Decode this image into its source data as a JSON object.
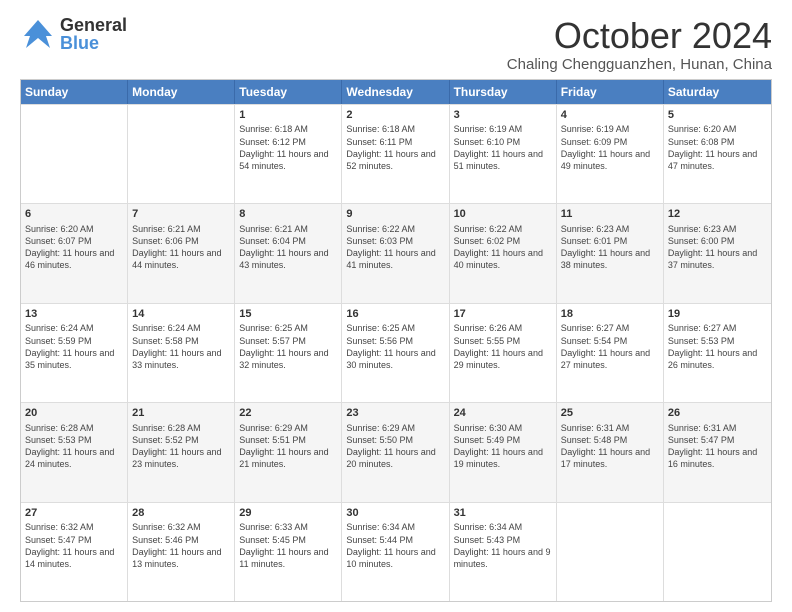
{
  "logo": {
    "general": "General",
    "blue": "Blue"
  },
  "title": "October 2024",
  "location": "Chaling Chengguanzhen, Hunan, China",
  "days_of_week": [
    "Sunday",
    "Monday",
    "Tuesday",
    "Wednesday",
    "Thursday",
    "Friday",
    "Saturday"
  ],
  "weeks": [
    [
      {
        "day": "",
        "info": ""
      },
      {
        "day": "",
        "info": ""
      },
      {
        "day": "1",
        "info": "Sunrise: 6:18 AM\nSunset: 6:12 PM\nDaylight: 11 hours and 54 minutes."
      },
      {
        "day": "2",
        "info": "Sunrise: 6:18 AM\nSunset: 6:11 PM\nDaylight: 11 hours and 52 minutes."
      },
      {
        "day": "3",
        "info": "Sunrise: 6:19 AM\nSunset: 6:10 PM\nDaylight: 11 hours and 51 minutes."
      },
      {
        "day": "4",
        "info": "Sunrise: 6:19 AM\nSunset: 6:09 PM\nDaylight: 11 hours and 49 minutes."
      },
      {
        "day": "5",
        "info": "Sunrise: 6:20 AM\nSunset: 6:08 PM\nDaylight: 11 hours and 47 minutes."
      }
    ],
    [
      {
        "day": "6",
        "info": "Sunrise: 6:20 AM\nSunset: 6:07 PM\nDaylight: 11 hours and 46 minutes."
      },
      {
        "day": "7",
        "info": "Sunrise: 6:21 AM\nSunset: 6:06 PM\nDaylight: 11 hours and 44 minutes."
      },
      {
        "day": "8",
        "info": "Sunrise: 6:21 AM\nSunset: 6:04 PM\nDaylight: 11 hours and 43 minutes."
      },
      {
        "day": "9",
        "info": "Sunrise: 6:22 AM\nSunset: 6:03 PM\nDaylight: 11 hours and 41 minutes."
      },
      {
        "day": "10",
        "info": "Sunrise: 6:22 AM\nSunset: 6:02 PM\nDaylight: 11 hours and 40 minutes."
      },
      {
        "day": "11",
        "info": "Sunrise: 6:23 AM\nSunset: 6:01 PM\nDaylight: 11 hours and 38 minutes."
      },
      {
        "day": "12",
        "info": "Sunrise: 6:23 AM\nSunset: 6:00 PM\nDaylight: 11 hours and 37 minutes."
      }
    ],
    [
      {
        "day": "13",
        "info": "Sunrise: 6:24 AM\nSunset: 5:59 PM\nDaylight: 11 hours and 35 minutes."
      },
      {
        "day": "14",
        "info": "Sunrise: 6:24 AM\nSunset: 5:58 PM\nDaylight: 11 hours and 33 minutes."
      },
      {
        "day": "15",
        "info": "Sunrise: 6:25 AM\nSunset: 5:57 PM\nDaylight: 11 hours and 32 minutes."
      },
      {
        "day": "16",
        "info": "Sunrise: 6:25 AM\nSunset: 5:56 PM\nDaylight: 11 hours and 30 minutes."
      },
      {
        "day": "17",
        "info": "Sunrise: 6:26 AM\nSunset: 5:55 PM\nDaylight: 11 hours and 29 minutes."
      },
      {
        "day": "18",
        "info": "Sunrise: 6:27 AM\nSunset: 5:54 PM\nDaylight: 11 hours and 27 minutes."
      },
      {
        "day": "19",
        "info": "Sunrise: 6:27 AM\nSunset: 5:53 PM\nDaylight: 11 hours and 26 minutes."
      }
    ],
    [
      {
        "day": "20",
        "info": "Sunrise: 6:28 AM\nSunset: 5:53 PM\nDaylight: 11 hours and 24 minutes."
      },
      {
        "day": "21",
        "info": "Sunrise: 6:28 AM\nSunset: 5:52 PM\nDaylight: 11 hours and 23 minutes."
      },
      {
        "day": "22",
        "info": "Sunrise: 6:29 AM\nSunset: 5:51 PM\nDaylight: 11 hours and 21 minutes."
      },
      {
        "day": "23",
        "info": "Sunrise: 6:29 AM\nSunset: 5:50 PM\nDaylight: 11 hours and 20 minutes."
      },
      {
        "day": "24",
        "info": "Sunrise: 6:30 AM\nSunset: 5:49 PM\nDaylight: 11 hours and 19 minutes."
      },
      {
        "day": "25",
        "info": "Sunrise: 6:31 AM\nSunset: 5:48 PM\nDaylight: 11 hours and 17 minutes."
      },
      {
        "day": "26",
        "info": "Sunrise: 6:31 AM\nSunset: 5:47 PM\nDaylight: 11 hours and 16 minutes."
      }
    ],
    [
      {
        "day": "27",
        "info": "Sunrise: 6:32 AM\nSunset: 5:47 PM\nDaylight: 11 hours and 14 minutes."
      },
      {
        "day": "28",
        "info": "Sunrise: 6:32 AM\nSunset: 5:46 PM\nDaylight: 11 hours and 13 minutes."
      },
      {
        "day": "29",
        "info": "Sunrise: 6:33 AM\nSunset: 5:45 PM\nDaylight: 11 hours and 11 minutes."
      },
      {
        "day": "30",
        "info": "Sunrise: 6:34 AM\nSunset: 5:44 PM\nDaylight: 11 hours and 10 minutes."
      },
      {
        "day": "31",
        "info": "Sunrise: 6:34 AM\nSunset: 5:43 PM\nDaylight: 11 hours and 9 minutes."
      },
      {
        "day": "",
        "info": ""
      },
      {
        "day": "",
        "info": ""
      }
    ]
  ],
  "alt_bg_weeks": [
    1,
    3
  ],
  "colors": {
    "header_bg": "#4a7fc1",
    "alt_row_bg": "#f5f5f5",
    "normal_row_bg": "#ffffff"
  }
}
